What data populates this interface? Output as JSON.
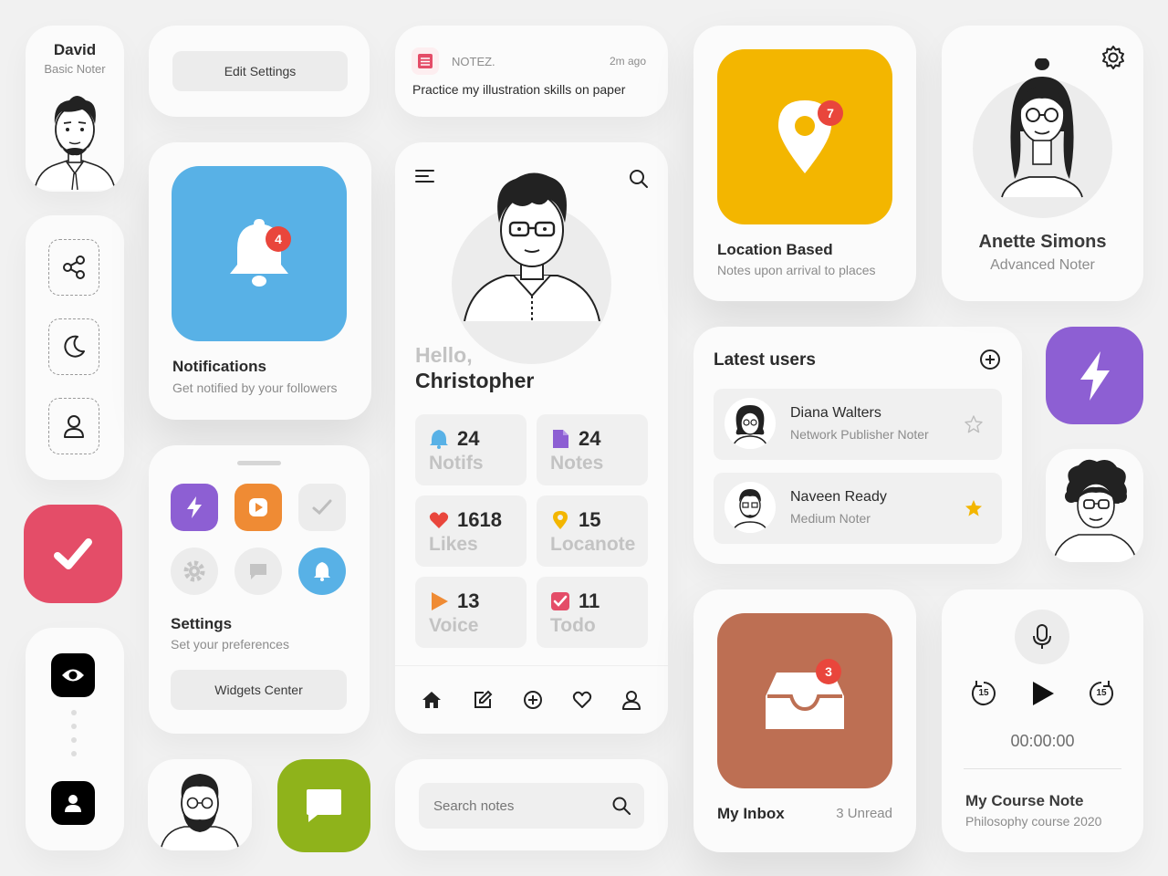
{
  "profile_david": {
    "name": "David",
    "role": "Basic Noter"
  },
  "edit_settings": {
    "label": "Edit Settings"
  },
  "notez": {
    "app": "NOTEZ.",
    "time": "2m ago",
    "text": "Practice my illustration skills on paper"
  },
  "notifications": {
    "title": "Notifications",
    "subtitle": "Get notified by your followers",
    "badge": "4",
    "color": "#58b1e6"
  },
  "location": {
    "title": "Location Based",
    "subtitle": "Notes upon arrival to places",
    "badge": "7",
    "color": "#f3b600"
  },
  "anette": {
    "name": "Anette Simons",
    "role": "Advanced Noter"
  },
  "main": {
    "greeting": "Hello,",
    "name": "Christopher",
    "stats": [
      {
        "count": "24",
        "label": "Notifs",
        "icon": "bell-icon",
        "color": "#58b1e6"
      },
      {
        "count": "24",
        "label": "Notes",
        "icon": "note-icon",
        "color": "#8d5fd3"
      },
      {
        "count": "1618",
        "label": "Likes",
        "icon": "heart-icon",
        "color": "#e9463c"
      },
      {
        "count": "15",
        "label": "Locanote",
        "icon": "pin-icon",
        "color": "#f3b600"
      },
      {
        "count": "13",
        "label": "Voice",
        "icon": "play-icon",
        "color": "#ef8b34"
      },
      {
        "count": "11",
        "label": "Todo",
        "icon": "check-icon",
        "color": "#e44d68"
      }
    ]
  },
  "latest_users": {
    "title": "Latest users",
    "users": [
      {
        "name": "Diana Walters",
        "role": "Network Publisher Noter",
        "starred": false
      },
      {
        "name": "Naveen Ready",
        "role": "Medium Noter",
        "starred": true
      }
    ]
  },
  "settings": {
    "title": "Settings",
    "subtitle": "Set your preferences",
    "button": "Widgets Center",
    "colors": {
      "purple": "#8d5fd3",
      "orange": "#ef8b34",
      "blue": "#58b1e6"
    }
  },
  "search": {
    "placeholder": "Search notes"
  },
  "inbox": {
    "title": "My Inbox",
    "unread": "3 Unread",
    "badge": "3",
    "color": "#bd6f53"
  },
  "course": {
    "time": "00:00:00",
    "title": "My Course Note",
    "subtitle": "Philosophy course 2020",
    "skip_back": "15",
    "skip_fwd": "15"
  },
  "colors": {
    "todo": "#e44d68",
    "chat": "#8fb31b",
    "bolt": "#8d5fd3",
    "star": "#f3b600"
  }
}
